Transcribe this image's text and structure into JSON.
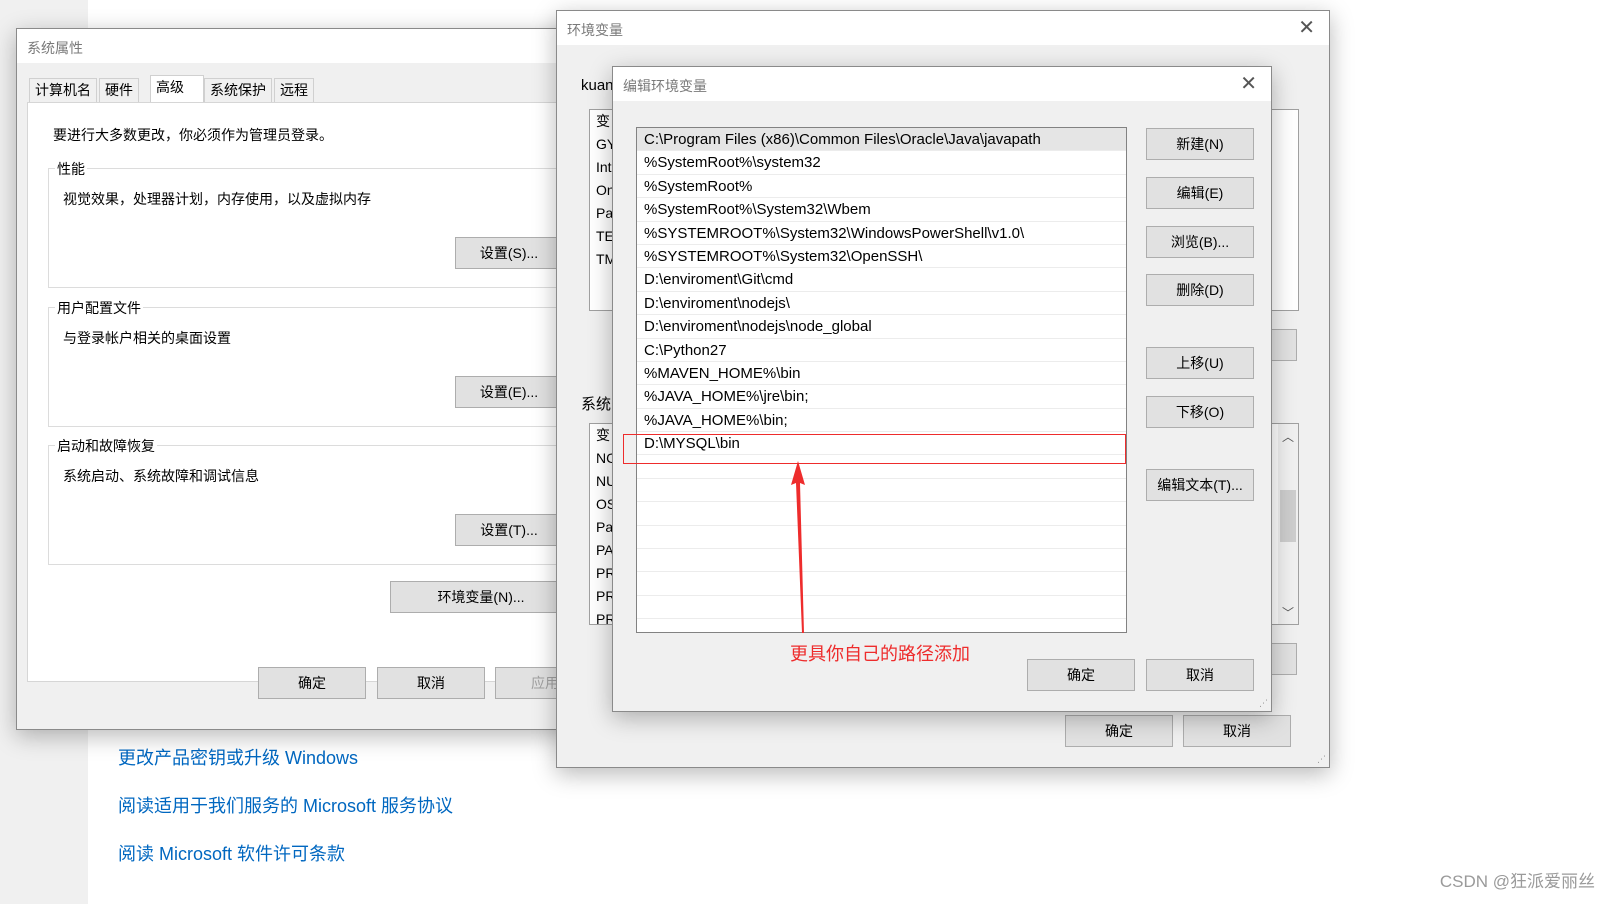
{
  "background_page": {
    "links": [
      "更改产品密钥或升级 Windows",
      "阅读适用于我们服务的 Microsoft 服务协议",
      "阅读 Microsoft 软件许可条款"
    ],
    "watermark": "CSDN @狂派爱丽丝"
  },
  "system_properties": {
    "title": "系统属性",
    "tabs": [
      "计算机名",
      "硬件",
      "高级",
      "系统保护",
      "远程"
    ],
    "active_tab": "高级",
    "admin_note": "要进行大多数更改，你必须作为管理员登录。",
    "performance": {
      "label": "性能",
      "desc": "视觉效果，处理器计划，内存使用，以及虚拟内存",
      "button": "设置(S)..."
    },
    "user_profiles": {
      "label": "用户配置文件",
      "desc": "与登录帐户相关的桌面设置",
      "button": "设置(E)..."
    },
    "startup_recovery": {
      "label": "启动和故障恢复",
      "desc": "系统启动、系统故障和调试信息",
      "button": "设置(T)..."
    },
    "env_button": "环境变量(N)...",
    "ok": "确定",
    "cancel": "取消",
    "apply": "应用"
  },
  "env_vars": {
    "title": "环境变量",
    "user_section_label": "kuan",
    "user_rows": [
      "变",
      "GY",
      "Int",
      "On",
      "Pa",
      "TE",
      "TM"
    ],
    "system_section_label": "系统",
    "system_rows": [
      "变",
      "NC",
      "NU",
      "OS",
      "Pa",
      "PA",
      "PR",
      "PR",
      "PR"
    ],
    "ok": "确定",
    "cancel": "取消"
  },
  "edit_dialog": {
    "title": "编辑环境变量",
    "paths": [
      "C:\\Program Files (x86)\\Common Files\\Oracle\\Java\\javapath",
      "%SystemRoot%\\system32",
      "%SystemRoot%",
      "%SystemRoot%\\System32\\Wbem",
      "%SYSTEMROOT%\\System32\\WindowsPowerShell\\v1.0\\",
      "%SYSTEMROOT%\\System32\\OpenSSH\\",
      "D:\\enviroment\\Git\\cmd",
      "D:\\enviroment\\nodejs\\",
      "D:\\enviroment\\nodejs\\node_global",
      "C:\\Python27",
      "%MAVEN_HOME%\\bin",
      "%JAVA_HOME%\\jre\\bin;",
      "%JAVA_HOME%\\bin;",
      "D:\\MYSQL\\bin",
      "",
      "",
      "",
      "",
      "",
      "",
      "",
      ""
    ],
    "selected_index": 0,
    "highlighted_index": 13,
    "buttons": {
      "new": "新建(N)",
      "edit": "编辑(E)",
      "browse": "浏览(B)...",
      "delete": "删除(D)",
      "up": "上移(U)",
      "down": "下移(O)",
      "edit_text": "编辑文本(T)..."
    },
    "ok": "确定",
    "cancel": "取消",
    "annotation": "更具你自己的路径添加",
    "annotation_color": "#ee2c2c"
  }
}
